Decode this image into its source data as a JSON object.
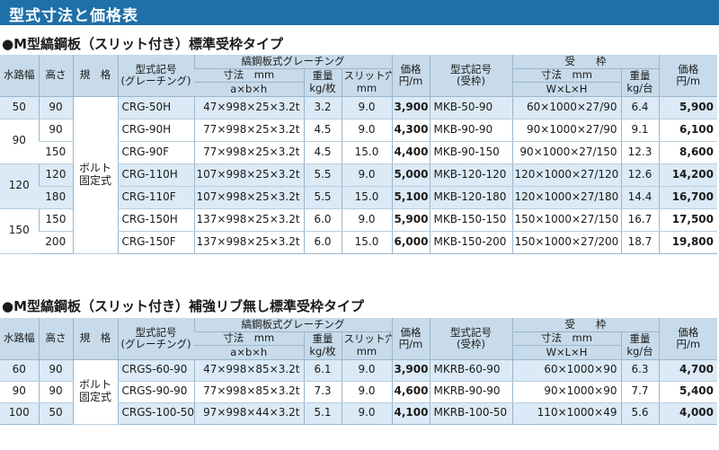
{
  "page_title": "型式寸法と価格表",
  "sections": [
    {
      "title": "●M型縞鋼板（スリット付き）標準受枠タイプ",
      "header": {
        "width": "水路幅",
        "height": "高さ",
        "spec": "規　格",
        "model_grating_1": "型式記号",
        "model_grating_2": "(グレーチング)",
        "grating_group": "縞鋼板式グレーチング",
        "dims_1": "寸法　mm",
        "dims_2": "a×b×h",
        "weight_g_1": "重量",
        "weight_g_2": "kg/枚",
        "slit_1": "スリット穴",
        "slit_2": "mm",
        "price_g_1": "価格",
        "price_g_2": "円/m",
        "model_frame_1": "型式記号",
        "model_frame_2": "(受枠)",
        "frame_group": "受　　枠",
        "fdims_1": "寸法　mm",
        "fdims_2": "W×L×H",
        "weight_f_1": "重量",
        "weight_f_2": "kg/台",
        "price_f_1": "価格",
        "price_f_2": "円/m"
      },
      "spec_text": "ボルト\n固定式",
      "groups": [
        {
          "width": "50",
          "rows": [
            {
              "height": "90",
              "model": "CRG-50H",
              "dims": "47×998×25×3.2t",
              "weight": "3.2",
              "slit": "9.0",
              "price": "3,900",
              "fmodel": "MKB-50-90",
              "fdims": "60×1000×27/90",
              "fweight": "6.4",
              "fprice": "5,900"
            }
          ]
        },
        {
          "width": "90",
          "rows": [
            {
              "height": "90",
              "model": "CRG-90H",
              "dims": "77×998×25×3.2t",
              "weight": "4.5",
              "slit": "9.0",
              "price": "4,300",
              "fmodel": "MKB-90-90",
              "fdims": "90×1000×27/90",
              "fweight": "9.1",
              "fprice": "6,100"
            },
            {
              "height": "150",
              "model": "CRG-90F",
              "dims": "77×998×25×3.2t",
              "weight": "4.5",
              "slit": "15.0",
              "price": "4,400",
              "fmodel": "MKB-90-150",
              "fdims": "90×1000×27/150",
              "fweight": "12.3",
              "fprice": "8,600"
            }
          ]
        },
        {
          "width": "120",
          "rows": [
            {
              "height": "120",
              "model": "CRG-110H",
              "dims": "107×998×25×3.2t",
              "weight": "5.5",
              "slit": "9.0",
              "price": "5,000",
              "fmodel": "MKB-120-120",
              "fdims": "120×1000×27/120",
              "fweight": "12.6",
              "fprice": "14,200"
            },
            {
              "height": "180",
              "model": "CRG-110F",
              "dims": "107×998×25×3.2t",
              "weight": "5.5",
              "slit": "15.0",
              "price": "5,100",
              "fmodel": "MKB-120-180",
              "fdims": "120×1000×27/180",
              "fweight": "14.4",
              "fprice": "16,700"
            }
          ]
        },
        {
          "width": "150",
          "rows": [
            {
              "height": "150",
              "model": "CRG-150H",
              "dims": "137×998×25×3.2t",
              "weight": "6.0",
              "slit": "9.0",
              "price": "5,900",
              "fmodel": "MKB-150-150",
              "fdims": "150×1000×27/150",
              "fweight": "16.7",
              "fprice": "17,500"
            },
            {
              "height": "200",
              "model": "CRG-150F",
              "dims": "137×998×25×3.2t",
              "weight": "6.0",
              "slit": "15.0",
              "price": "6,000",
              "fmodel": "MKB-150-200",
              "fdims": "150×1000×27/200",
              "fweight": "18.7",
              "fprice": "19,800"
            }
          ]
        }
      ]
    },
    {
      "title": "●M型縞鋼板（スリット付き）補強リブ無し標準受枠タイプ",
      "header": {
        "width": "水路幅",
        "height": "高さ",
        "spec": "規　格",
        "model_grating_1": "型式記号",
        "model_grating_2": "(グレーチング)",
        "grating_group": "縞鋼板式グレーチング",
        "dims_1": "寸法　mm",
        "dims_2": "a×b×h",
        "weight_g_1": "重量",
        "weight_g_2": "kg/枚",
        "slit_1": "スリット穴",
        "slit_2": "mm",
        "price_g_1": "価格",
        "price_g_2": "円/m",
        "model_frame_1": "型式記号",
        "model_frame_2": "(受枠)",
        "frame_group": "受　　枠",
        "fdims_1": "寸法　mm",
        "fdims_2": "W×L×H",
        "weight_f_1": "重量",
        "weight_f_2": "kg/台",
        "price_f_1": "価格",
        "price_f_2": "円/m"
      },
      "spec_text": "ボルト\n固定式",
      "groups": [
        {
          "width": "60",
          "rows": [
            {
              "height": "90",
              "model": "CRGS-60-90",
              "dims": "47×998×85×3.2t",
              "weight": "6.1",
              "slit": "9.0",
              "price": "3,900",
              "fmodel": "MKRB-60-90",
              "fdims": "60×1000×90",
              "fweight": "6.3",
              "fprice": "4,700"
            }
          ]
        },
        {
          "width": "90",
          "rows": [
            {
              "height": "90",
              "model": "CRGS-90-90",
              "dims": "77×998×85×3.2t",
              "weight": "7.3",
              "slit": "9.0",
              "price": "4,600",
              "fmodel": "MKRB-90-90",
              "fdims": "90×1000×90",
              "fweight": "7.7",
              "fprice": "5,400"
            }
          ]
        },
        {
          "width": "100",
          "rows": [
            {
              "height": "50",
              "model": "CRGS-100-50",
              "dims": "97×998×44×3.2t",
              "weight": "5.1",
              "slit": "9.0",
              "price": "4,100",
              "fmodel": "MKRB-100-50",
              "fdims": "110×1000×49",
              "fweight": "5.6",
              "fprice": "4,000"
            }
          ]
        }
      ]
    }
  ]
}
